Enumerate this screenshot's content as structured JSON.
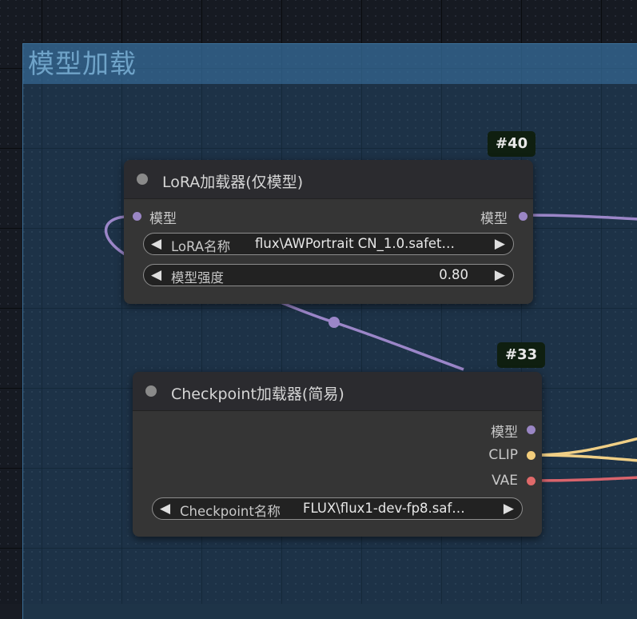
{
  "group": {
    "title": "模型加载"
  },
  "nodes": {
    "lora": {
      "id": "#40",
      "title": "LoRA加载器(仅模型)",
      "input_model": "模型",
      "output_model": "模型",
      "widgets": [
        {
          "name": "LoRA名称",
          "value": "flux\\AWPortrait CN_1.0.safet…"
        },
        {
          "name": "模型强度",
          "value": "0.80"
        }
      ]
    },
    "checkpoint": {
      "id": "#33",
      "title": "Checkpoint加载器(简易)",
      "outputs": [
        "模型",
        "CLIP",
        "VAE"
      ],
      "widgets": [
        {
          "name": "Checkpoint名称",
          "value": "FLUX\\flux1-dev-fp8.saf…"
        }
      ]
    }
  },
  "icons": {
    "left_arrow": "◀",
    "right_arrow": "▶"
  },
  "colors": {
    "model_slot": "#9a86c4",
    "clip_slot": "#f3cd7b",
    "vae_slot": "#e06a6a",
    "model_wire": "#9b86c8",
    "clip_wire": "#f0cf86",
    "vae_wire": "#d9646c"
  }
}
